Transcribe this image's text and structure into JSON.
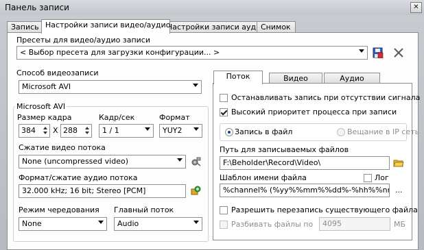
{
  "window": {
    "title": "Панель записи",
    "close_glyph": "✕"
  },
  "tabs": [
    {
      "label": "Запись"
    },
    {
      "label": "Настройки записи видео/аудио"
    },
    {
      "label": "Настройки записи аудио"
    },
    {
      "label": "Снимок"
    }
  ],
  "presets": {
    "label": "Пресеты для видео/аудио записи",
    "value": "< Выбор пресета для загрузки конфигурации... >",
    "save_icon": "save-disk-icon",
    "delete_icon": "delete-x-icon"
  },
  "recording_method": {
    "label": "Способ видеозаписи",
    "value": "Microsoft AVI"
  },
  "avi": {
    "group_title": "Microsoft AVI",
    "frame_size_label": "Размер кадра",
    "width": "384",
    "x_sep": "X",
    "height": "288",
    "fps_label": "Кадр/сек",
    "fps_value": "1 / 1",
    "format_label": "Формат",
    "format_value": "YUY2",
    "video_compression_label": "Сжатие видео потока",
    "video_compression_value": "None (uncompressed video)",
    "audio_label": "Формат/сжатие аудио потока",
    "audio_value": "32.000 kHz; 16 bit; Stereo [PCM]",
    "interleave_label": "Режим чередования",
    "interleave_value": "None",
    "master_stream_label": "Главный поток",
    "master_stream_value": "Audio"
  },
  "right_tabs": [
    {
      "label": "Поток"
    },
    {
      "label": "Видео"
    },
    {
      "label": "Аудио"
    }
  ],
  "stream": {
    "stop_no_signal_label": "Останавливать запись при отсутствии сигнала",
    "stop_no_signal_checked": false,
    "high_priority_label": "Высокий приоритет процесса при записи",
    "high_priority_checked": true,
    "record_to_file_label": "Запись в файл",
    "broadcast_label": "Вещание в IP сеть",
    "path_label": "Путь для записываемых файлов",
    "path_value": "F:\\Beholder\\Record\\Video\\",
    "template_label": "Шаблон имени файла",
    "log_label": "Лог",
    "log_checked": false,
    "template_value": "%channel% (%yy%%mm%%dd%-%hh%%nn%",
    "ellipsis": "...",
    "overwrite_label": "Разрешить перезапись существующего файла",
    "overwrite_checked": false,
    "split_label": "Разбивать файлы по",
    "split_value": "4095",
    "split_unit": "МБ"
  }
}
